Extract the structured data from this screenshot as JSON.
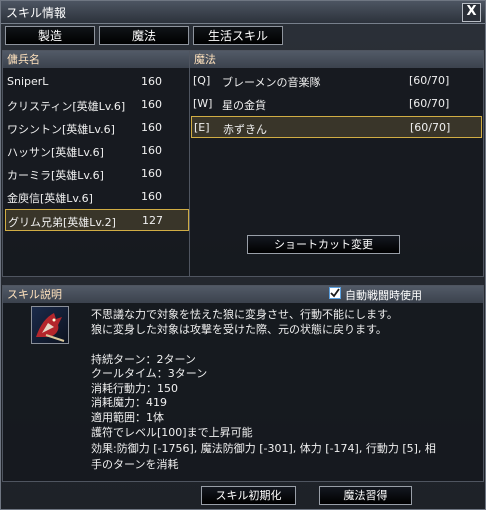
{
  "window": {
    "title": "スキル情報",
    "close_label": "X"
  },
  "tabs": [
    {
      "label": "製造"
    },
    {
      "label": "魔法"
    },
    {
      "label": "生活スキル"
    }
  ],
  "mercenary_panel": {
    "header": "傭兵名",
    "items": [
      {
        "name": "SniperL",
        "value": "160"
      },
      {
        "name": "クリスティン[英雄Lv.6]",
        "value": "160"
      },
      {
        "name": "ワシントン[英雄Lv.6]",
        "value": "160"
      },
      {
        "name": "ハッサン[英雄Lv.6]",
        "value": "160"
      },
      {
        "name": "カーミラ[英雄Lv.6]",
        "value": "160"
      },
      {
        "name": "金庾信[英雄Lv.6]",
        "value": "160"
      },
      {
        "name": "グリム兄弟[英雄Lv.2]",
        "value": "127"
      }
    ],
    "selected_index": 6
  },
  "magic_panel": {
    "header": "魔法",
    "items": [
      {
        "key": "[Q]",
        "name": "ブレーメンの音楽隊",
        "count": "[60/70]"
      },
      {
        "key": "[W]",
        "name": "星の金貨",
        "count": "[60/70]"
      },
      {
        "key": "[E]",
        "name": "赤ずきん",
        "count": "[60/70]"
      }
    ],
    "selected_index": 2,
    "shortcut_button": "ショートカット変更"
  },
  "description": {
    "header": "スキル説明",
    "auto_checkbox_label": "自動戦闘時使用",
    "auto_checked": true,
    "lines": [
      "不思議な力で対象を怯えた狼に変身させ、行動不能にします。",
      "狼に変身した対象は攻撃を受けた際、元の状態に戻ります。",
      "",
      "持続ターン：2ターン",
      "クールタイム：3ターン",
      "消耗行動力：150",
      "消耗魔力：419",
      "適用範囲：1体",
      "護符でレベル[100]まで上昇可能",
      "効果:防御力 [-1756], 魔法防御力 [-301], 体力 [-174], 行動力 [5], 相",
      "手のターンを消耗"
    ]
  },
  "footer": {
    "reset_button": "スキル初期化",
    "learn_button": "魔法習得"
  },
  "colors": {
    "header_text": "#ffe2bd",
    "selection_border": "#d1ad44",
    "checkbox": "#5aa0e0"
  }
}
